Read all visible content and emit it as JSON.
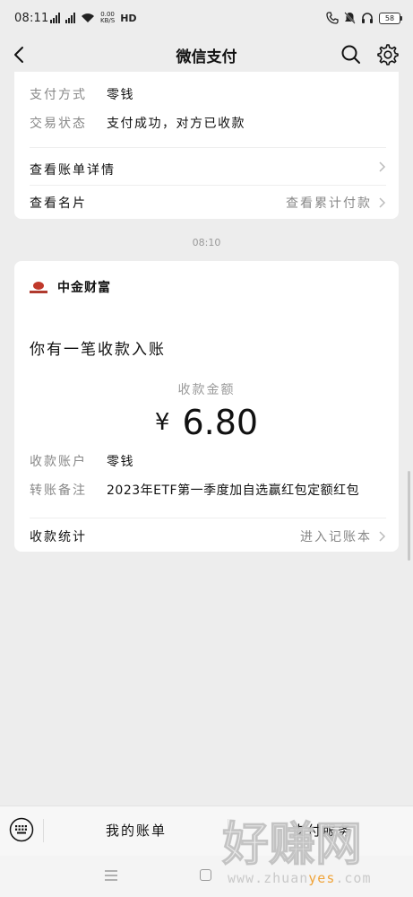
{
  "status_bar": {
    "time": "08:11",
    "net_speed_value": "0.00",
    "net_speed_unit": "KB/S",
    "hd": "HD",
    "battery": "58"
  },
  "nav": {
    "title": "微信支付"
  },
  "top_card": {
    "rows": [
      {
        "label": "支付方式",
        "value": "零钱"
      },
      {
        "label": "交易状态",
        "value": "支付成功，对方已收款"
      }
    ],
    "bill_detail": "查看账单详情",
    "card_label": "查看名片",
    "card_right": "查看累计付款"
  },
  "timestamp": "08:10",
  "notice": {
    "merchant": "中金财富",
    "headline": "你有一笔收款入账",
    "amount_label": "收款金额",
    "currency": "¥",
    "amount": "6.80",
    "rows": [
      {
        "label": "收款账户",
        "value": "零钱"
      },
      {
        "label": "转账备注",
        "value": "2023年ETF第一季度加自选赢红包定额红包"
      }
    ],
    "stats_label": "收款统计",
    "stats_right": "进入记账本"
  },
  "bottom_bar": {
    "tab_bills": "我的账单",
    "tab_services": "支付服务"
  },
  "watermark": {
    "main": "好赚网",
    "url_prefix": "www.zhuan",
    "url_highlight": "yes",
    "url_suffix": ".com"
  },
  "icons": {
    "back": "back-arrow-icon",
    "search": "search-icon",
    "settings": "gear-icon",
    "keyboard": "keyboard-icon",
    "chevron": "chevron-right-icon"
  },
  "colors": {
    "background": "#ededed",
    "card": "#ffffff",
    "label": "#888888",
    "merchant_red": "#c0392b",
    "watermark_accent": "#f0a43a"
  }
}
